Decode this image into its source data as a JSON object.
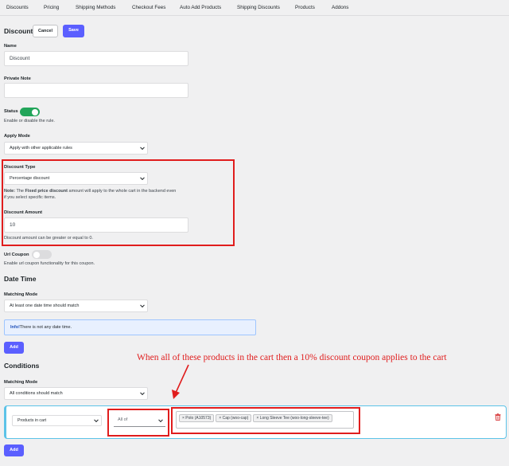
{
  "tabs": [
    "Discounts",
    "Pricing",
    "Shipping Methods",
    "Checkout Fees",
    "Auto Add Products",
    "Shipping Discounts",
    "Products",
    "Addons"
  ],
  "header": {
    "title": "Discount",
    "cancel_label": "Cancel",
    "save_label": "Save"
  },
  "name": {
    "label": "Name",
    "value": "Discount"
  },
  "private_note": {
    "label": "Private Note",
    "value": ""
  },
  "status": {
    "label": "Status",
    "help": "Enable or disable the rule.",
    "enabled": true
  },
  "apply_mode": {
    "label": "Apply Mode",
    "value": "Apply with other applicable rules"
  },
  "discount_type": {
    "label": "Discount Type",
    "value": "Percentage discount",
    "note_prefix": "Note:",
    "note_text_1": " The ",
    "note_bold": "Fixed price discount",
    "note_text_2": " amount will apply to the whole cart in the backend even",
    "note_line2": "if you select specific items."
  },
  "discount_amount": {
    "label": "Discount Amount",
    "value": "10",
    "help": "Discount amount can be greater or equal to 0."
  },
  "url_coupon": {
    "label": "Url Coupon",
    "help": "Enable url coupon functionality for this coupon.",
    "enabled": false
  },
  "date_time": {
    "title": "Date Time",
    "matching_label": "Matching Mode",
    "matching_value": "At least one date time should match",
    "info_bold": "Info!",
    "info_text": " There is not any date time.",
    "add_label": "Add"
  },
  "conditions": {
    "title": "Conditions",
    "matching_label": "Matching Mode",
    "matching_value": "All conditions should match",
    "condition_type": "Products in cart",
    "operator": "All of",
    "products": [
      "× Polo (A10573)",
      "× Cap (woo-cap)",
      "× Long Sleeve Tee (woo-long-sleeve-tee)"
    ],
    "add_label": "Add"
  },
  "annotation": "When all of these products in the cart then a 10% discount coupon applies to the cart",
  "colors": {
    "primary": "#5b5fff",
    "toggle_on": "#22a55a",
    "toggle_off": "#dcdcde",
    "annotation_red": "#e01d1d",
    "condition_border": "#5cc3e8",
    "delete_icon": "#d63638"
  }
}
